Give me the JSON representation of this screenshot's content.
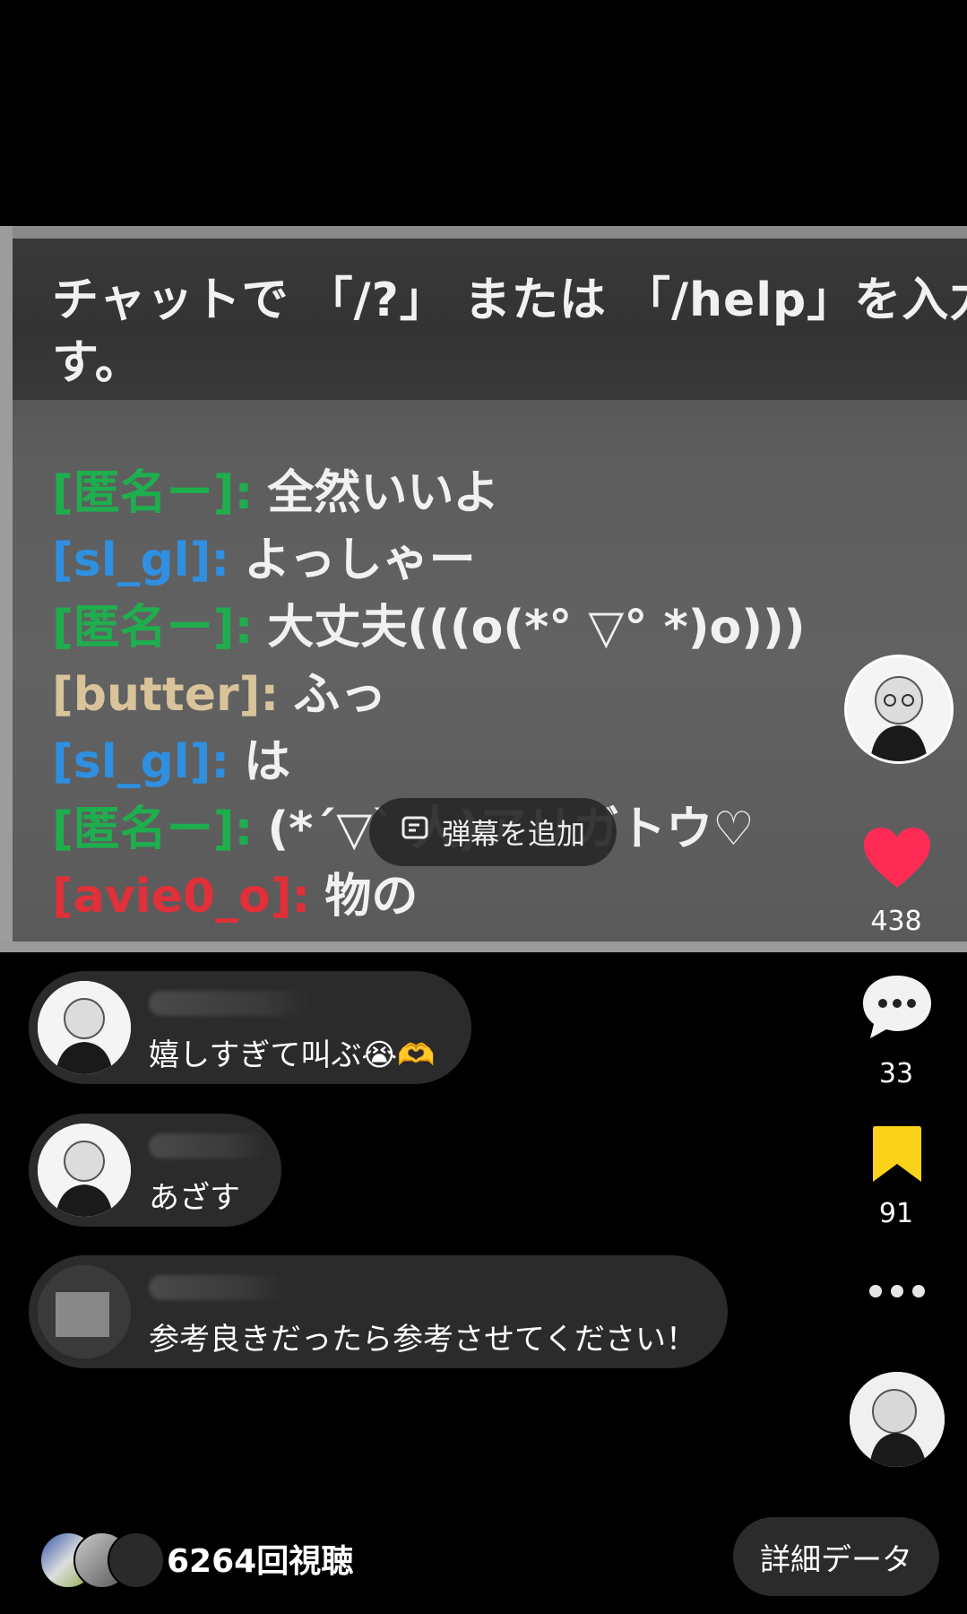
{
  "video": {
    "system_line1": "チャットで 「/?」 または 「/help」を入力す",
    "system_line2": "す。",
    "chat": [
      {
        "name": "[匿名ー]:",
        "message": "全然いいよ",
        "color": "#1fae4e"
      },
      {
        "name": "[sl_gl]:",
        "message": "よっしゃー",
        "color": "#2f8fe0"
      },
      {
        "name": "[匿名ー]:",
        "message": "大丈夫(((o(*° ▽° *)o)))",
        "color": "#1fae4e"
      },
      {
        "name": "[butter]:",
        "message": "ふっ",
        "color": "#d8c39a"
      },
      {
        "name": "[sl_gl]:",
        "message": "は",
        "color": "#2f8fe0"
      },
      {
        "name": "[匿名ー]:",
        "message": "(*´▽` 人)アリガトウ♡",
        "color": "#1fae4e"
      },
      {
        "name": "[avie0_o]:",
        "message": "物の",
        "color": "#e0303a"
      }
    ],
    "danmaku_label": "弾幕を追加"
  },
  "rail": {
    "like_count": "438",
    "comment_count": "33",
    "save_count": "91",
    "like_color": "#fe2c55",
    "save_color": "#fcd31b"
  },
  "comments": [
    {
      "text": "嬉しすぎて叫ぶ😭🫶"
    },
    {
      "text": "あざす"
    },
    {
      "text": "参考良きだったら参考させてください！"
    }
  ],
  "footer": {
    "views": "6264回視聴",
    "detail_button": "詳細データ"
  }
}
